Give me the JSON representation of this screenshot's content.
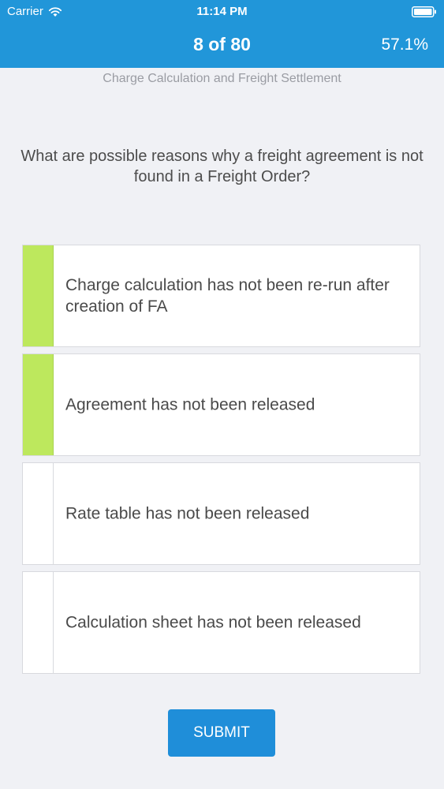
{
  "status_bar": {
    "carrier": "Carrier",
    "time": "11:14 PM"
  },
  "nav": {
    "question_counter": "8 of 80",
    "score_percent": "57.1%"
  },
  "quiz": {
    "category": "Charge Calculation and Freight Settlement",
    "question": "What are possible reasons why a freight agreement is not found in a Freight Order?",
    "answers": [
      {
        "label": "Charge calculation has not been re-run after creation of FA",
        "selected": true
      },
      {
        "label": "Agreement has not been released",
        "selected": true
      },
      {
        "label": "Rate table has not been released",
        "selected": false
      },
      {
        "label": "Calculation sheet has not been released",
        "selected": false
      }
    ],
    "submit_label": "SUBMIT"
  },
  "colors": {
    "header": "#2196d9",
    "selected_marker": "#bde85d",
    "submit_button": "#1f8ed9",
    "background": "#f0f1f5"
  },
  "icons": {
    "wifi": "wifi-icon",
    "battery": "battery-icon"
  }
}
